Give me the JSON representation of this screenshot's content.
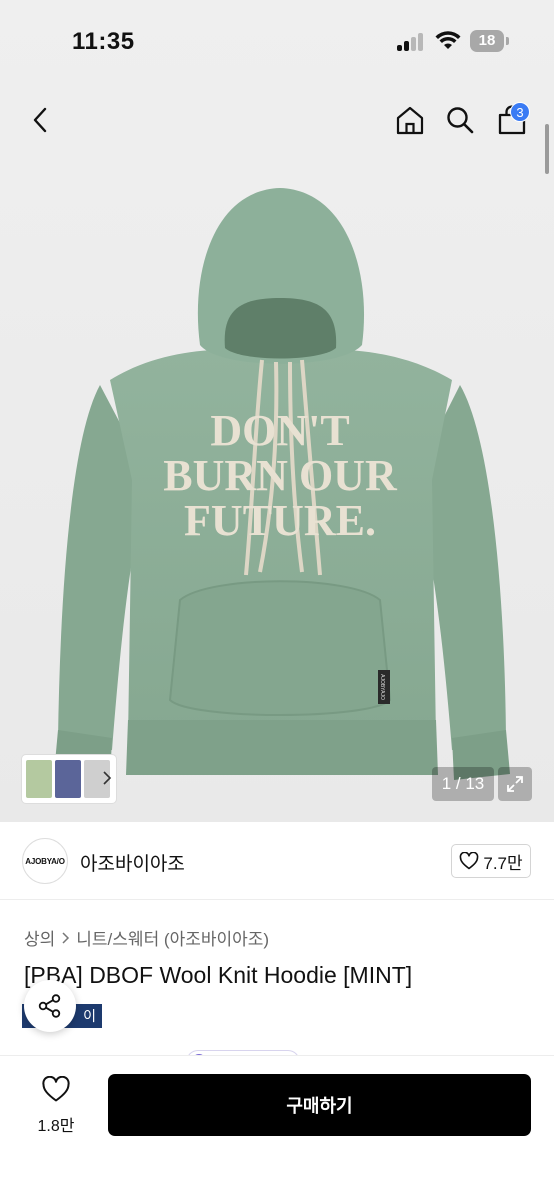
{
  "status": {
    "time": "11:35",
    "battery": "18"
  },
  "header": {
    "cart_badge": "3"
  },
  "gallery": {
    "counter": "1 / 13",
    "garment_text": [
      "DON'T",
      "BURN OUR",
      "FUTURE."
    ],
    "label_text": "AJOBYAJO",
    "colors": {
      "knit": "#8fb09a",
      "print": "#e8e1d2",
      "background": "#ececec"
    }
  },
  "shop": {
    "logo_text": "AJOBYA/O",
    "name": "아조바이아조",
    "likes": "7.7만"
  },
  "breadcrumb": {
    "first": "상의",
    "second": "니트/스웨터 (아조바이아조)"
  },
  "product": {
    "title": "[PBA] DBOF Wool Knit Hoodie [MINT]",
    "tag": "이"
  },
  "bottom": {
    "wish_count": "1.8만",
    "buy_label": "구매하기"
  },
  "theme": {
    "accent": "#3a7bf4",
    "tag_bg": "#1d3a6e",
    "cta_bg": "#000000"
  }
}
